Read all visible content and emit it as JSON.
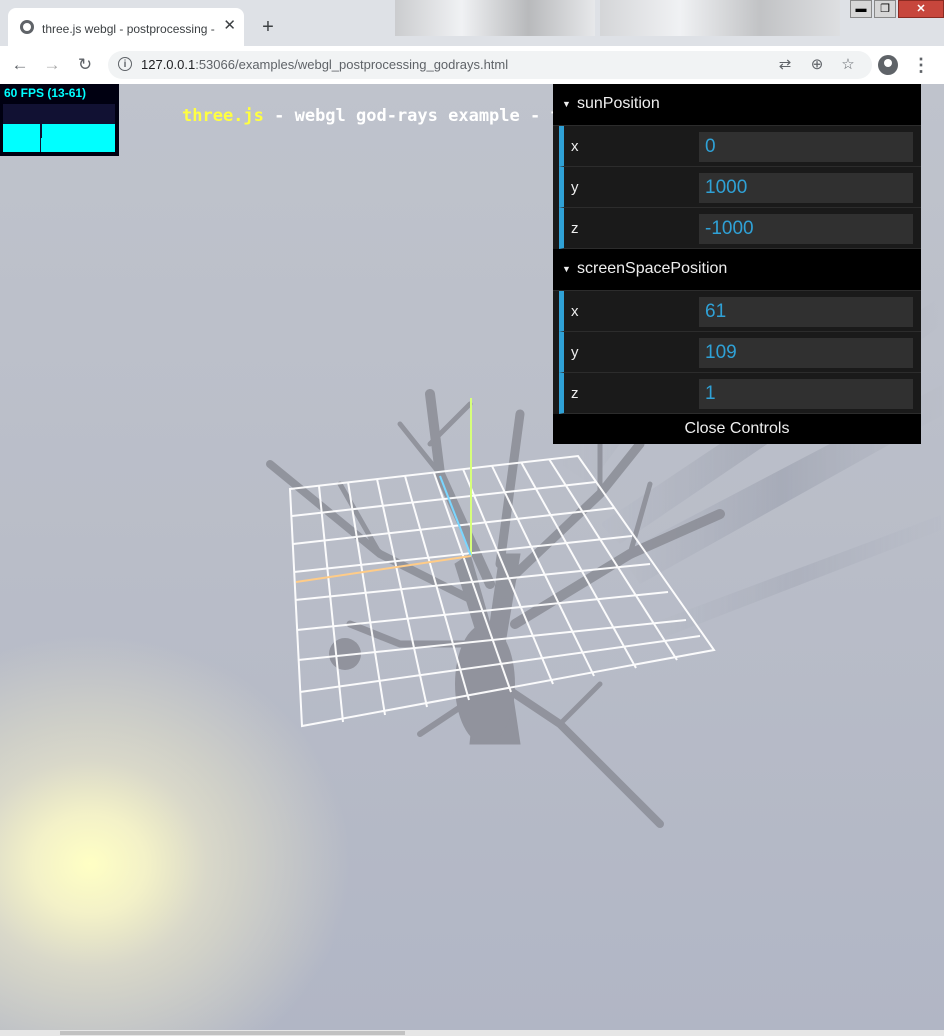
{
  "browser": {
    "tab_title": "three.js webgl - postprocessing - god-rays",
    "tab_close": "✕",
    "new_tab": "+",
    "window_buttons": {
      "minimize": "▬",
      "maximize": "❐",
      "close": "✕"
    },
    "url_host": "127.0.0.1",
    "url_rest": ":53066/examples/webgl_postprocessing_godrays.html",
    "nav": {
      "back": "←",
      "forward": "→",
      "reload": "↻"
    },
    "icons": {
      "translate": "⇄",
      "zoom": "⊕",
      "bookmark": "☆",
      "menu": "⋮",
      "info": "i"
    }
  },
  "page": {
    "info_link": "three.js",
    "info_text": " - webgl god-rays example - tree by stanford"
  },
  "stats": {
    "fps_label": "60 FPS (13-61)",
    "fps": 60,
    "fps_min": 13,
    "fps_max": 61
  },
  "gui": {
    "folders": [
      {
        "title": "sunPosition",
        "rows": [
          {
            "label": "x",
            "value": "0"
          },
          {
            "label": "y",
            "value": "1000"
          },
          {
            "label": "z",
            "value": "-1000"
          }
        ]
      },
      {
        "title": "screenSpacePosition",
        "rows": [
          {
            "label": "x",
            "value": "61"
          },
          {
            "label": "y",
            "value": "109"
          },
          {
            "label": "z",
            "value": "1"
          }
        ]
      }
    ],
    "close_label": "Close Controls"
  },
  "colors": {
    "accent": "#2fa1d6",
    "link_yellow": "#ffff41",
    "stats_cyan": "#00ffff",
    "sun": "#ffffc4"
  }
}
